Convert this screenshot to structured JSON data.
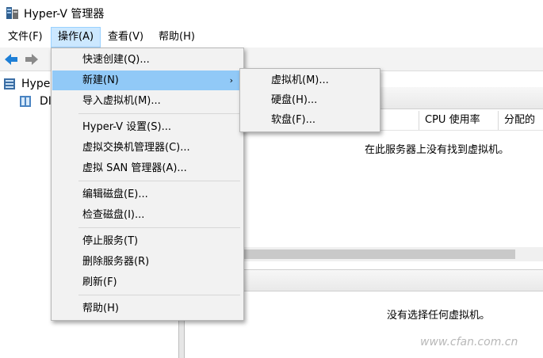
{
  "window": {
    "title": "Hyper-V 管理器"
  },
  "menubar": {
    "items": [
      {
        "label": "文件(F)"
      },
      {
        "label": "操作(A)"
      },
      {
        "label": "查看(V)"
      },
      {
        "label": "帮助(H)"
      }
    ]
  },
  "toolbar": {
    "back_icon": "back-arrow-icon",
    "forward_icon": "forward-arrow-icon"
  },
  "tree": {
    "root_label": "Hyper",
    "server_label": "DI"
  },
  "vm_list": {
    "columns": [
      "CPU 使用率",
      "分配的"
    ],
    "empty_message": "在此服务器上没有找到虚拟机。"
  },
  "details": {
    "empty_message": "没有选择任何虚拟机。"
  },
  "context_menu": {
    "items": [
      {
        "label": "快速创建(Q)..."
      },
      {
        "label": "新建(N)",
        "submenu_arrow": "›"
      },
      {
        "label": "导入虚拟机(M)..."
      },
      {
        "label": "Hyper-V 设置(S)..."
      },
      {
        "label": "虚拟交换机管理器(C)..."
      },
      {
        "label": "虚拟 SAN 管理器(A)..."
      },
      {
        "label": "编辑磁盘(E)..."
      },
      {
        "label": "检查磁盘(I)..."
      },
      {
        "label": "停止服务(T)"
      },
      {
        "label": "删除服务器(R)"
      },
      {
        "label": "刷新(F)"
      },
      {
        "label": "帮助(H)"
      }
    ]
  },
  "submenu": {
    "items": [
      {
        "label": "虚拟机(M)..."
      },
      {
        "label": "硬盘(H)..."
      },
      {
        "label": "软盘(F)..."
      }
    ]
  },
  "watermark": "www.cfan.com.cn",
  "colors": {
    "highlight": "#91c9f7",
    "menu_active": "#cce8ff",
    "menu_bg": "#f2f2f2",
    "arrow_blue": "#1e7fd6"
  }
}
